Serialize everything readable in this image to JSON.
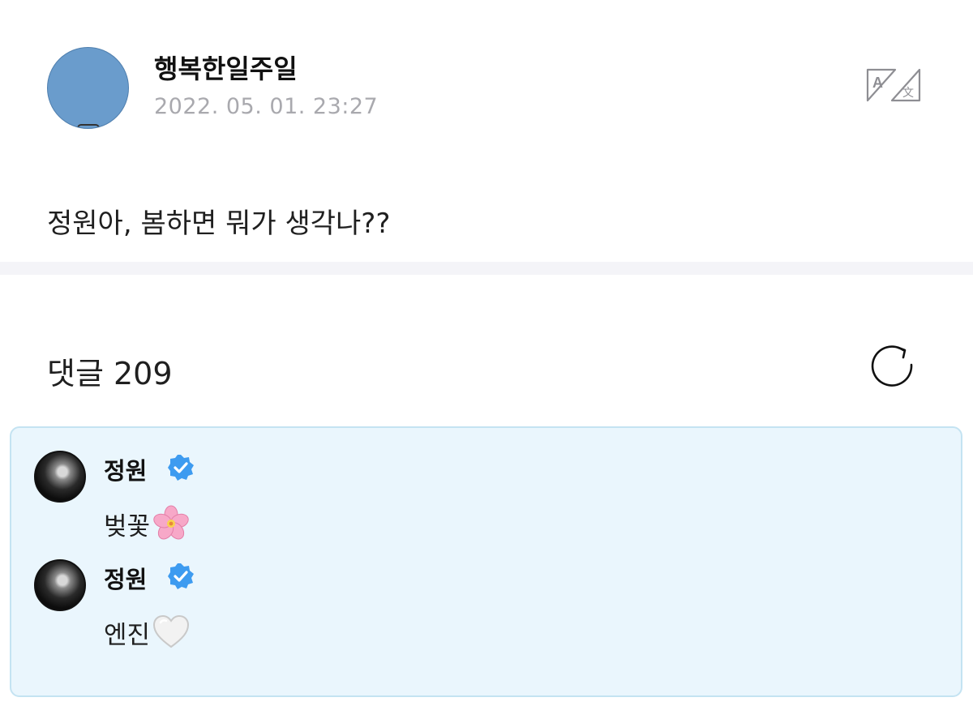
{
  "post": {
    "author": "행복한일주일",
    "date": "2022. 05. 01. 23:27",
    "text": "정원아, 봄하면 뭐가 생각나??",
    "avatar_color": "#6a9ccc",
    "translate_icon": "translate-icon"
  },
  "comments": {
    "label": "댓글 209",
    "refresh_icon": "refresh-icon",
    "highlight_bg": "#eaf6fd",
    "items": [
      {
        "name": "정원",
        "text": "벚꽃",
        "emoji": "cherry-blossom-icon",
        "verified": true
      },
      {
        "name": "정원",
        "text": "엔진",
        "emoji": "white-heart-icon",
        "verified": true
      }
    ]
  },
  "colors": {
    "verified": "#3d9bf0",
    "date_text": "#a9a9ae",
    "divider": "#f4f4f8"
  }
}
